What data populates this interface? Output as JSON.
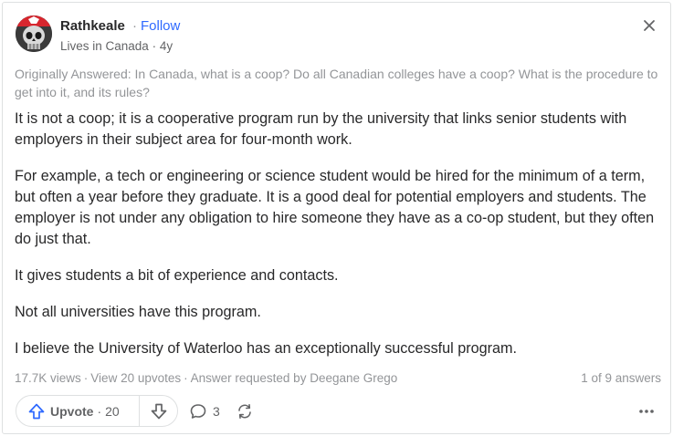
{
  "author": {
    "name": "Rathkeale",
    "follow_label": "Follow",
    "credential": "Lives in Canada",
    "age": "4y"
  },
  "original_question": "Originally Answered: In Canada, what is a coop? Do all Canadian colleges have a coop? What is the procedure to get into it, and its rules?",
  "answer_paragraphs": [
    "It is not a coop; it is a cooperative program run by the university that links senior students with employers in their subject area for four-month work.",
    "For example, a tech or engineering or science student would be hired for the minimum of a term, but often a year before they graduate. It is a good deal for potential employers and students. The employer is not under any obligation to hire someone they have as a co-op student, but they often do just that.",
    "It gives students a bit of experience and contacts.",
    "Not all universities have this program.",
    "I believe the University of Waterloo has an exceptionally successful program."
  ],
  "stats": {
    "views": "17.7K views",
    "upvotes": "View 20 upvotes",
    "requested": "Answer requested by Deegane Grego",
    "answers_count": "1 of 9 answers"
  },
  "actions": {
    "upvote_label": "Upvote",
    "upvote_count": "20",
    "comment_count": "3"
  },
  "icons": {
    "close": "close-icon",
    "upvote": "upvote-arrow-icon",
    "downvote": "downvote-arrow-icon",
    "comment": "comment-bubble-icon",
    "share": "share-arrows-icon",
    "more": "more-dots-icon"
  },
  "colors": {
    "link_blue": "#2e69ff",
    "text": "#282829",
    "muted": "#939598",
    "secondary": "#636466",
    "border": "#dee0e1"
  }
}
